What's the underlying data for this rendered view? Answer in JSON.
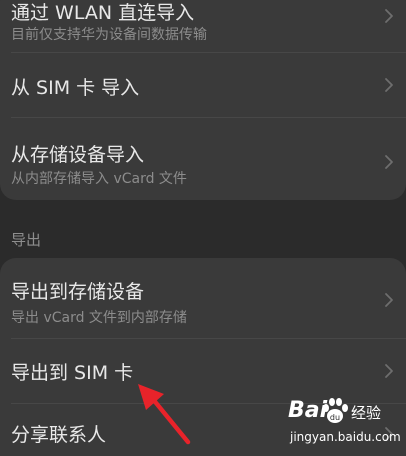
{
  "import_section": {
    "items": [
      {
        "title": "通过 WLAN 直连导入",
        "subtitle": "目前仅支持华为设备间数据传输"
      },
      {
        "title": "从 SIM 卡 导入"
      },
      {
        "title": "从存储设备导入",
        "subtitle": "从内部存储导入 vCard 文件"
      }
    ]
  },
  "export_section": {
    "label": "导出",
    "items": [
      {
        "title": "导出到存储设备",
        "subtitle": "导出 vCard 文件到内部存储"
      },
      {
        "title": "导出到 SIM 卡"
      },
      {
        "title": "分享联系人"
      }
    ]
  },
  "annotation": {
    "arrow_color": "#e8232a"
  },
  "watermark": {
    "brand": "Bai",
    "brand_suffix": "经验",
    "url": "jingyan.baidu.com"
  },
  "colors": {
    "background": "#2b2b2b",
    "card": "#3a3a3a",
    "primary_text": "#e8e8e8",
    "secondary_text": "#8c8c8c"
  }
}
